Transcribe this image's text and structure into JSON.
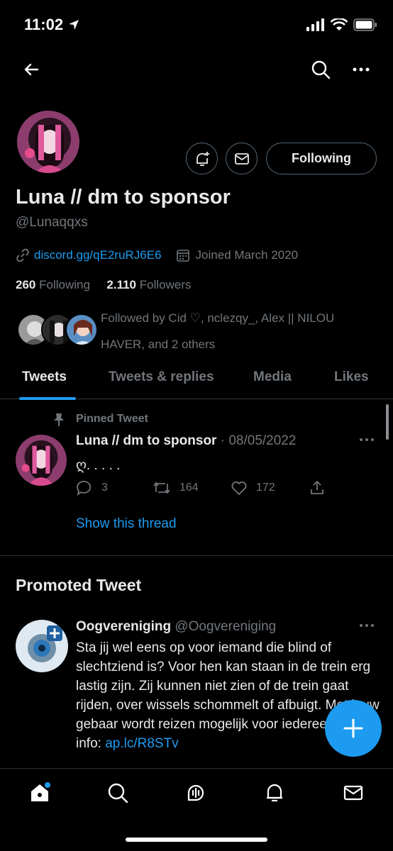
{
  "status_bar": {
    "time": "11:02"
  },
  "profile": {
    "name": "Luna // dm to sponsor",
    "handle": "@Lunaqqxs",
    "link": "discord.gg/qE2ruRJ6E6",
    "joined": "Joined March 2020",
    "following_count": "260",
    "following_label": "Following",
    "followers_count": "2.110",
    "followers_label": "Followers",
    "followed_by": "Followed by Cid ♡, nclezqy_, Alex || NILOU HAVER, and 2 others",
    "follow_button_label": "Following"
  },
  "tabs": [
    {
      "label": "Tweets",
      "active": true
    },
    {
      "label": "Tweets & replies",
      "active": false
    },
    {
      "label": "Media",
      "active": false
    },
    {
      "label": "Likes",
      "active": false
    }
  ],
  "pinned_tweet": {
    "pinned_label": "Pinned Tweet",
    "author_name": "Luna // dm to sponsor",
    "date": "· 08/05/2022",
    "text": "ღ. . . . .",
    "replies": "3",
    "retweets": "164",
    "likes": "172",
    "show_thread": "Show this thread"
  },
  "promoted": {
    "section_title": "Promoted Tweet",
    "author_name": "Oogvereniging",
    "author_handle": "@Oogvereniging",
    "text": "Sta jij wel eens op voor iemand die blind of slechtziend is? Voor hen kan staan in de trein erg lastig zijn. Zij kunnen niet zien of de trein gaat rijden, over wissels schommelt of afbuigt. Met jouw gebaar wordt reizen mogelijk voor iedereen! Meer info:",
    "link": "ap.lc/R8STv"
  },
  "colors": {
    "accent": "#1d9bf0",
    "background": "#000000",
    "secondary_text": "#71767b",
    "border": "#2f3336"
  },
  "icons": {
    "nav": [
      "back-arrow-icon",
      "search-icon",
      "more-icon"
    ],
    "bottom_nav": [
      "home-icon",
      "search-icon",
      "spaces-icon",
      "notifications-icon",
      "messages-icon"
    ]
  }
}
